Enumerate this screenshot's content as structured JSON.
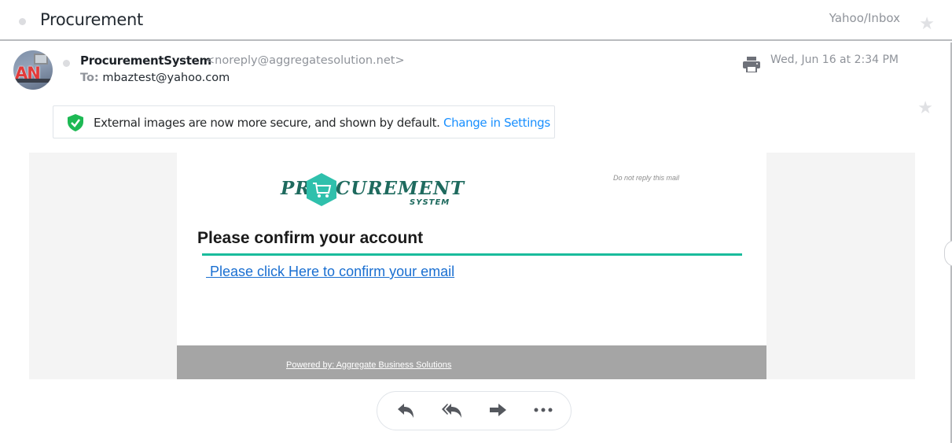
{
  "header": {
    "subject": "Procurement",
    "folder": "Yahoo/Inbox",
    "star_icon": "star-icon"
  },
  "message": {
    "sender_name": "ProcurementSystem",
    "sender_email": "<noreply@aggregatesolution.net>",
    "to_label": "To:",
    "to_address": "mbaztest@yahoo.com",
    "date": "Wed, Jun 16 at 2:34 PM",
    "avatar_initials": "AN",
    "print_icon": "printer-icon"
  },
  "notice": {
    "text": "External images are now more secure, and shown by default.",
    "link": "Change in Settings",
    "icon": "shield-check-icon"
  },
  "email_body": {
    "logo_left": "PR",
    "logo_right": "CUREMENT",
    "logo_sub": "SYSTEM",
    "no_reply": "Do not reply this mail",
    "title": "Please confirm your account",
    "confirm_link": " Please click Here to confirm your email",
    "footer": "Powered by: Aggregate Business Solutions",
    "colors": {
      "accent": "#1abc9c",
      "logo": "#1e6a5e",
      "link": "#1a6fd1",
      "footer_bg": "#a5a5a5"
    }
  },
  "actions": [
    {
      "name": "reply",
      "icon": "reply-icon"
    },
    {
      "name": "reply-all",
      "icon": "reply-all-icon"
    },
    {
      "name": "forward",
      "icon": "forward-icon"
    },
    {
      "name": "more",
      "icon": "more-icon"
    }
  ]
}
